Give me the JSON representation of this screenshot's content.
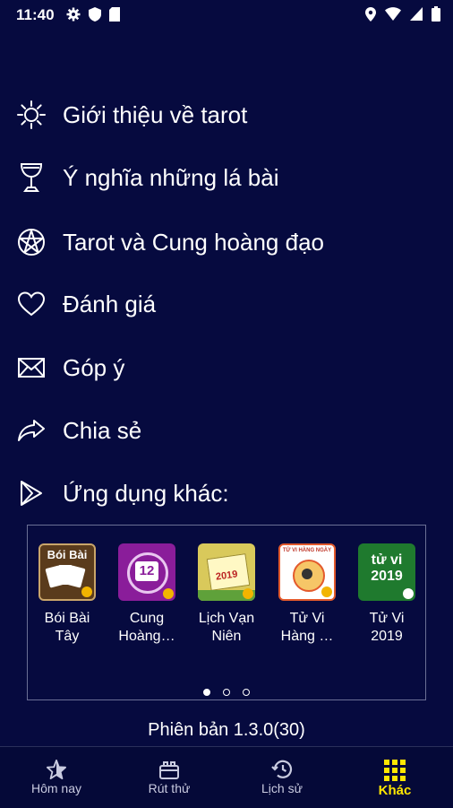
{
  "status": {
    "time": "11:40"
  },
  "menu": [
    {
      "label": "Giới thiệu về tarot",
      "icon": "sun-icon"
    },
    {
      "label": "Ý nghĩa những lá bài",
      "icon": "chalice-icon"
    },
    {
      "label": "Tarot và Cung hoàng đạo",
      "icon": "pentacle-icon"
    },
    {
      "label": "Đánh giá",
      "icon": "heart-icon"
    },
    {
      "label": "Góp ý",
      "icon": "mail-icon"
    },
    {
      "label": "Chia sẻ",
      "icon": "share-icon"
    },
    {
      "label": "Ứng dụng khác:",
      "icon": "play-icon"
    }
  ],
  "apps": [
    {
      "name_line1": "Bói Bài",
      "name_line2": "Tây",
      "icon_text": "Bói Bài"
    },
    {
      "name_line1": "Cung",
      "name_line2": "Hoàng…",
      "icon_text": "12"
    },
    {
      "name_line1": "Lịch Vạn",
      "name_line2": "Niên",
      "icon_text": "2019"
    },
    {
      "name_line1": "Tử Vi",
      "name_line2": "Hàng …",
      "icon_text": "TỬ VI HÀNG NGÀY"
    },
    {
      "name_line1": "Tử Vi",
      "name_line2": "2019",
      "icon_text": "tử vi 2019"
    }
  ],
  "pager": {
    "count": 3,
    "active": 1
  },
  "version": "Phiên bản 1.3.0(30)",
  "nav": [
    {
      "label": "Hôm nay",
      "icon": "star-icon",
      "active": false
    },
    {
      "label": "Rút thử",
      "icon": "cards-icon",
      "active": false
    },
    {
      "label": "Lịch sử",
      "icon": "history-icon",
      "active": false
    },
    {
      "label": "Khác",
      "icon": "grid-icon",
      "active": true
    }
  ],
  "colors": {
    "background": "#060a3f",
    "active_nav": "#ffe600"
  }
}
